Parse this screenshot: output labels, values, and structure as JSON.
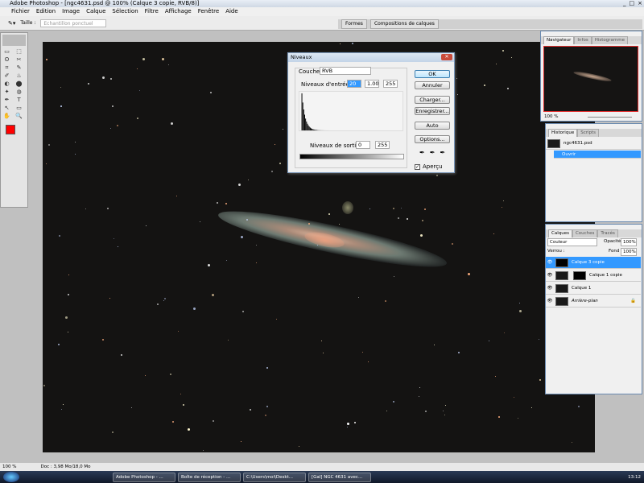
{
  "window": {
    "title": "Adobe Photoshop - [ngc4631.psd @ 100% (Calque 3 copie, RVB/8)]",
    "controls": [
      "_",
      "□",
      "×"
    ]
  },
  "menu": [
    "Fichier",
    "Edition",
    "Image",
    "Calque",
    "Sélection",
    "Filtre",
    "Affichage",
    "Fenêtre",
    "Aide"
  ],
  "options": {
    "size_label": "Taille :",
    "size_value": "Echantillon ponctuel"
  },
  "well_tabs": [
    "Formes",
    "Compositions de calques"
  ],
  "toolbox": {
    "tools": [
      "▭",
      "⬚",
      "ʘ",
      "✂",
      "⌗",
      "✎",
      "✐",
      "♨",
      "◐",
      "⬤",
      "✦",
      "◍",
      "✒",
      "T",
      "↖",
      "▭",
      "✋",
      "🔍"
    ],
    "foreground_color": "#ff0000",
    "background_color": "#ffffff"
  },
  "levels_dialog": {
    "title": "Niveaux",
    "channel_label": "Couche :",
    "channel": "RVB",
    "input_label": "Niveaux d'entrée :",
    "input_black": "20",
    "input_gamma": "1.00",
    "input_white": "255",
    "output_label": "Niveaux de sortie :",
    "output_black": "0",
    "output_white": "255",
    "buttons": [
      "OK",
      "Annuler",
      "Charger...",
      "Enregistrer...",
      "Auto",
      "Options..."
    ],
    "preview_label": "Aperçu",
    "preview_checked": true
  },
  "navigator": {
    "tabs": [
      "Navigateur",
      "Infos",
      "Histogramme"
    ],
    "zoom": "100 %"
  },
  "history": {
    "tabs": [
      "Historique",
      "Scripts"
    ],
    "snapshot": "ngc4631.psd",
    "items": [
      "Ouvrir"
    ]
  },
  "layers": {
    "tabs": [
      "Calques",
      "Couches",
      "Tracés"
    ],
    "blend_mode": "Couleur",
    "opacity_label": "Opacité :",
    "opacity": "100%",
    "lock_label": "Verrou :",
    "fill_label": "Fond :",
    "fill": "100%",
    "items": [
      {
        "name": "Calque 3 copie",
        "selected": true
      },
      {
        "name": "Calque 1 copie",
        "mask": true
      },
      {
        "name": "Calque 1"
      },
      {
        "name": "Arrière-plan",
        "locked": true
      }
    ]
  },
  "status": {
    "zoom": "100 %",
    "doc": "Doc : 3,98 Mo/18,0 Mo"
  },
  "taskbar": {
    "tasks": [
      "Adobe Photoshop - ...",
      "Boîte de réception - ...",
      "C:\\Users\\moi\\Deskt...",
      "[Gal] NGC 4631 avec..."
    ],
    "clock": "13:12"
  }
}
